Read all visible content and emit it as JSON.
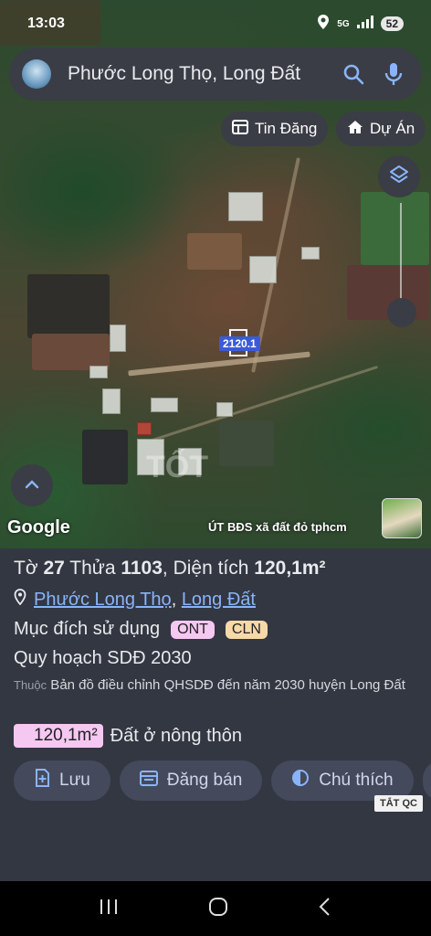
{
  "status_bar": {
    "time": "13:03",
    "network": "5G",
    "battery": "52"
  },
  "search": {
    "query": "Phước Long Thọ, Long Đất"
  },
  "map": {
    "chips": [
      "Tin Đăng",
      "Dự Án"
    ],
    "parcel_label": "2120.1",
    "watermark": "TỐT",
    "attribution": "Google",
    "owner_label": "ÚT BĐS xã đất đỏ tphcm"
  },
  "sheet": {
    "title": {
      "prefix1": "Tờ ",
      "sheet_no": "27",
      "prefix2": " Thửa ",
      "plot_no": "1103",
      "prefix3": ", Diện tích ",
      "area": "120,1m²"
    },
    "location": {
      "commune": "Phước Long Thọ",
      "sep": ", ",
      "district": "Long Đất"
    },
    "purpose": {
      "label": "Mục đích sử dụng",
      "tags": [
        {
          "text": "ONT",
          "color": "#f5c8f2"
        },
        {
          "text": "CLN",
          "color": "#f7d9a8"
        }
      ]
    },
    "plan": "Quy hoạch SDĐ 2030",
    "source": {
      "prefix": "Thuộc",
      "text": " Bản đồ điều chỉnh QHSDĐ đến năm 2030 huyện Long Đất"
    },
    "area_badge": "120,1m²",
    "area_desc": "Đất ở nông thôn",
    "actions": [
      "Lưu",
      "Đăng bán",
      "Chú thích"
    ],
    "ad_tag": "TẮT QC"
  }
}
